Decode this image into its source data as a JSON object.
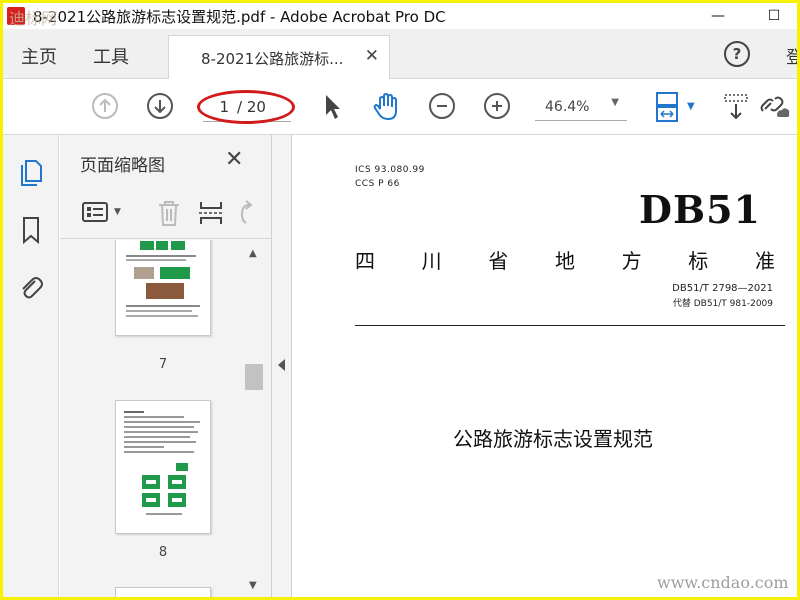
{
  "window": {
    "title": "8-2021公路旅游标志设置规范.pdf - Adobe Acrobat Pro DC",
    "minimize": "—",
    "maximize": "☐",
    "close": "✕"
  },
  "tabs": {
    "home": "主页",
    "tools": "工具",
    "document_tab": "8-2021公路旅游标...",
    "document_tab_close": "✕",
    "help": "?",
    "login": "登"
  },
  "toolbar": {
    "page_current": "1",
    "page_total": "/ 20",
    "zoom": "46.4%",
    "prev_page_icon": "arrow-up-circle",
    "next_page_icon": "arrow-down-circle",
    "zoom_out_icon": "minus-circle",
    "zoom_in_icon": "plus-circle",
    "highlight_color": "#d31a1a"
  },
  "thumbnails_panel": {
    "title": "页面缩略图",
    "close": "✕",
    "pages": [
      {
        "label": "7"
      },
      {
        "label": "8"
      }
    ]
  },
  "document": {
    "ics": "ICS 93.080.99",
    "ccs": "CCS P 66",
    "db_code": "DB51",
    "standard_chars": [
      "四",
      "川",
      "省",
      "地",
      "方",
      "标",
      "准"
    ],
    "standard_number": "DB51/T 2798—2021",
    "replaces": "代替 DB51/T 981-2009",
    "title": "公路旅游标志设置规范"
  },
  "watermarks": {
    "top_left": "迪标网",
    "bottom_right": "www.cndao.com"
  },
  "colors": {
    "frame": "#f6f200",
    "accent_blue": "#2277cc",
    "thumbnail_green": "#1f9a4a"
  }
}
